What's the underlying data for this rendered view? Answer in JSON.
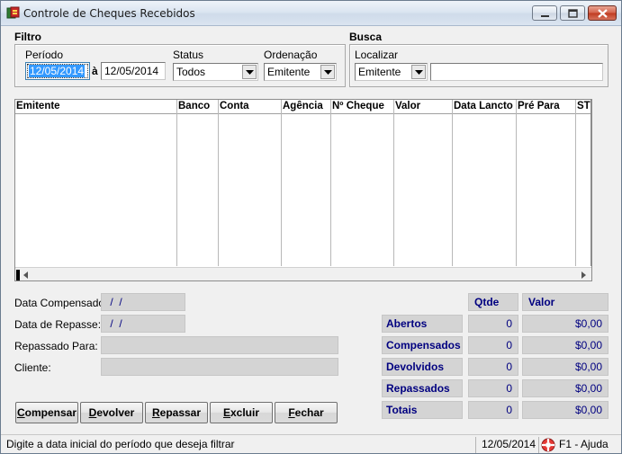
{
  "window": {
    "title": "Controle de Cheques Recebidos"
  },
  "filtro": {
    "title": "Filtro",
    "periodo_label": "Período",
    "date_from": "12/05/2014",
    "date_sep": "à",
    "date_to": "12/05/2014",
    "status_label": "Status",
    "status_value": "Todos",
    "ordenacao_label": "Ordenação",
    "ordenacao_value": "Emitente"
  },
  "busca": {
    "title": "Busca",
    "localizar_label": "Localizar",
    "localizar_field": "Emitente",
    "localizar_value": ""
  },
  "grid": {
    "columns": [
      "Emitente",
      "Banco",
      "Conta",
      "Agência",
      "Nº Cheque",
      "Valor",
      "Data Lancto",
      "Pré Para",
      "ST"
    ],
    "rows": []
  },
  "details": {
    "data_compensado_label": "Data Compensado:",
    "data_compensado_value": " /  /",
    "data_repasse_label": "Data de Repasse:",
    "data_repasse_value": " /  /",
    "repassado_para_label": "Repassado Para:",
    "repassado_para_value": "",
    "cliente_label": "Cliente:",
    "cliente_value": ""
  },
  "totals": {
    "qtde_header": "Qtde",
    "valor_header": "Valor",
    "rows": [
      {
        "label": "Abertos",
        "qtde": "0",
        "valor": "$0,00"
      },
      {
        "label": "Compensados",
        "qtde": "0",
        "valor": "$0,00"
      },
      {
        "label": "Devolvidos",
        "qtde": "0",
        "valor": "$0,00"
      },
      {
        "label": "Repassados",
        "qtde": "0",
        "valor": "$0,00"
      },
      {
        "label": "Totais",
        "qtde": "0",
        "valor": "$0,00"
      }
    ]
  },
  "buttons": {
    "compensar": {
      "first": "C",
      "rest": "ompensar"
    },
    "devolver": {
      "first": "D",
      "rest": "evolver"
    },
    "repassar": {
      "first": "R",
      "rest": "epassar"
    },
    "excluir": {
      "first": "E",
      "rest": "xcluir"
    },
    "fechar": {
      "first": "F",
      "rest": "echar"
    }
  },
  "status_bar": {
    "hint": "Digite a data inicial do período que deseja filtrar",
    "date": "12/05/2014",
    "help": "F1 - Ajuda"
  }
}
